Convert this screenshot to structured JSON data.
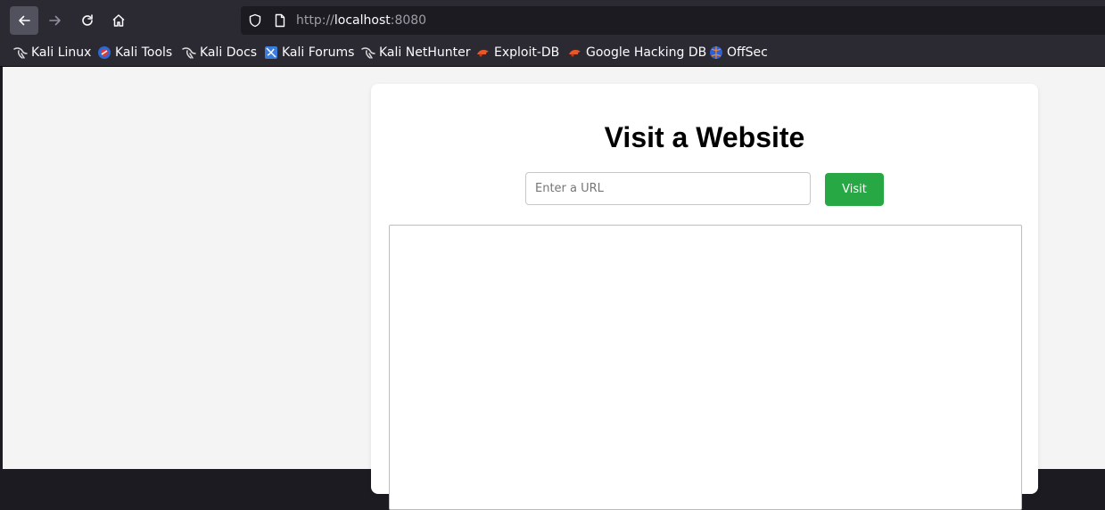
{
  "browser": {
    "url": {
      "scheme": "http://",
      "host": "localhost",
      "port": ":8080"
    },
    "icons": {
      "back": "arrow-left-icon",
      "forward": "arrow-right-icon",
      "reload": "reload-icon",
      "home": "home-icon",
      "tracking": "shield-icon",
      "page": "page-icon"
    }
  },
  "bookmarks": [
    {
      "label": "Kali Linux",
      "icon": "kali-dragon-icon"
    },
    {
      "label": "Kali Tools",
      "icon": "kali-tools-icon"
    },
    {
      "label": "Kali Docs",
      "icon": "kali-dragon-icon"
    },
    {
      "label": "Kali Forums",
      "icon": "kali-forums-icon"
    },
    {
      "label": "Kali NetHunter",
      "icon": "kali-dragon-icon"
    },
    {
      "label": "Exploit-DB",
      "icon": "exploit-db-icon"
    },
    {
      "label": "Google Hacking DB",
      "icon": "exploit-db-icon"
    },
    {
      "label": "OffSec",
      "icon": "offsec-icon"
    }
  ],
  "page": {
    "title": "Visit a Website",
    "url_input": {
      "placeholder": "Enter a URL",
      "value": ""
    },
    "visit_label": "Visit",
    "colors": {
      "visit_button": "#28a745",
      "background": "#f4f4f4",
      "card": "#ffffff"
    }
  }
}
